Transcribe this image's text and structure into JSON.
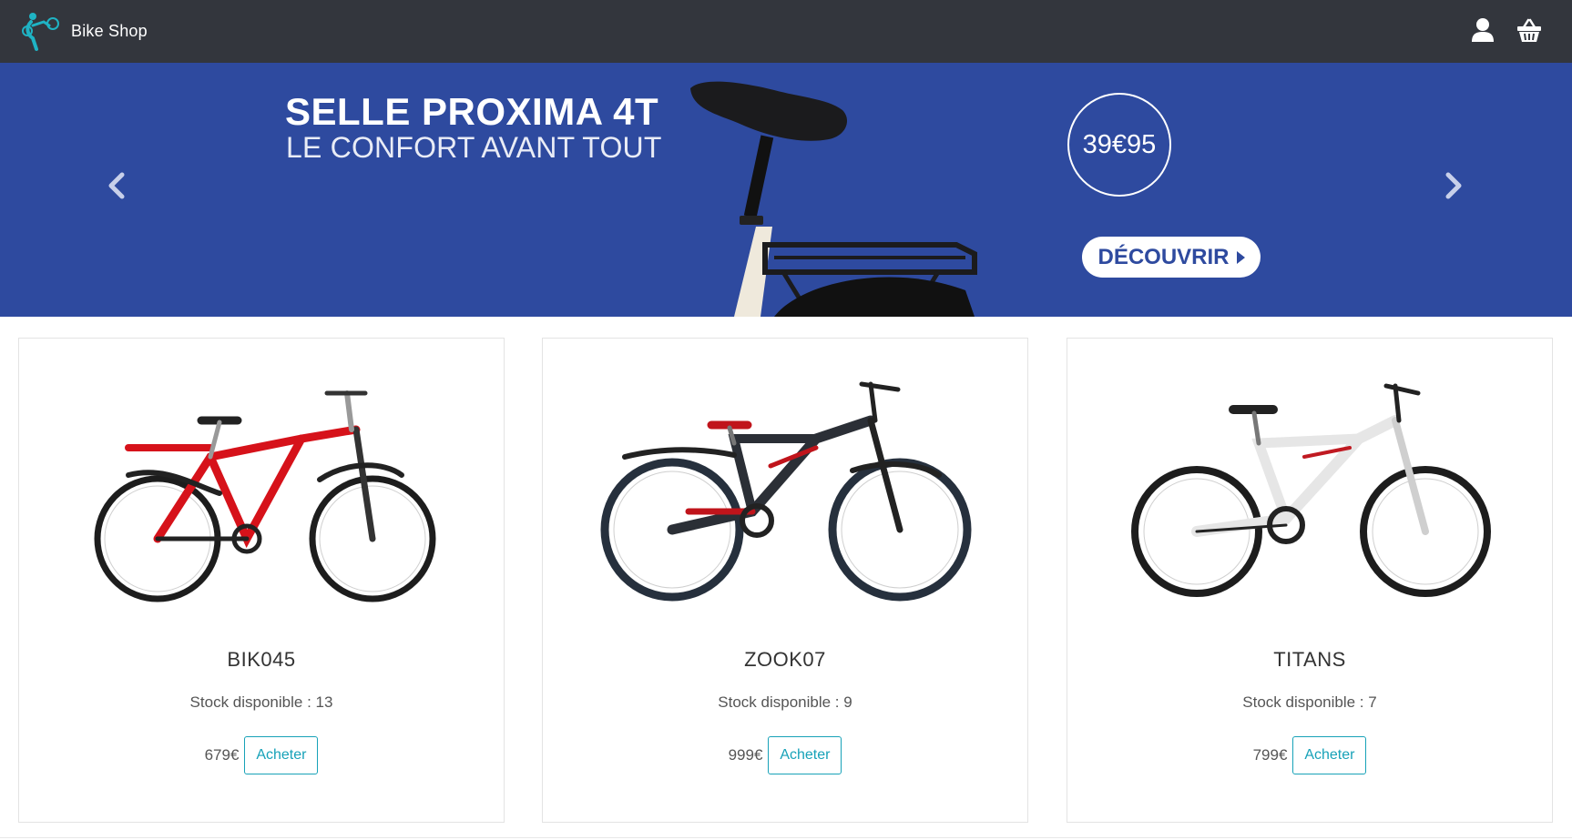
{
  "header": {
    "brand_name": "Bike Shop",
    "icons": [
      "bike-logo-icon",
      "user-icon",
      "basket-icon"
    ]
  },
  "banner": {
    "title": "SELLE PROXIMA 4T",
    "subtitle": "LE CONFORT AVANT TOUT",
    "price": "39€95",
    "cta_label": "DÉCOUVRIR",
    "prev_icon": "chevron-left-icon",
    "next_icon": "chevron-right-icon"
  },
  "products": [
    {
      "name": "BIK045",
      "stock": "Stock disponible : 13",
      "price": "679€",
      "buy_label": "Acheter",
      "color": "red"
    },
    {
      "name": "ZOOK07",
      "stock": "Stock disponible : 9",
      "price": "999€",
      "buy_label": "Acheter",
      "color": "black-red"
    },
    {
      "name": "TITANS",
      "stock": "Stock disponible : 7",
      "price": "799€",
      "buy_label": "Acheter",
      "color": "white"
    }
  ],
  "colors": {
    "navbar": "#33363d",
    "banner": "#2e4a9f",
    "accent": "#17a2b8",
    "logo": "#1fb3c4"
  }
}
